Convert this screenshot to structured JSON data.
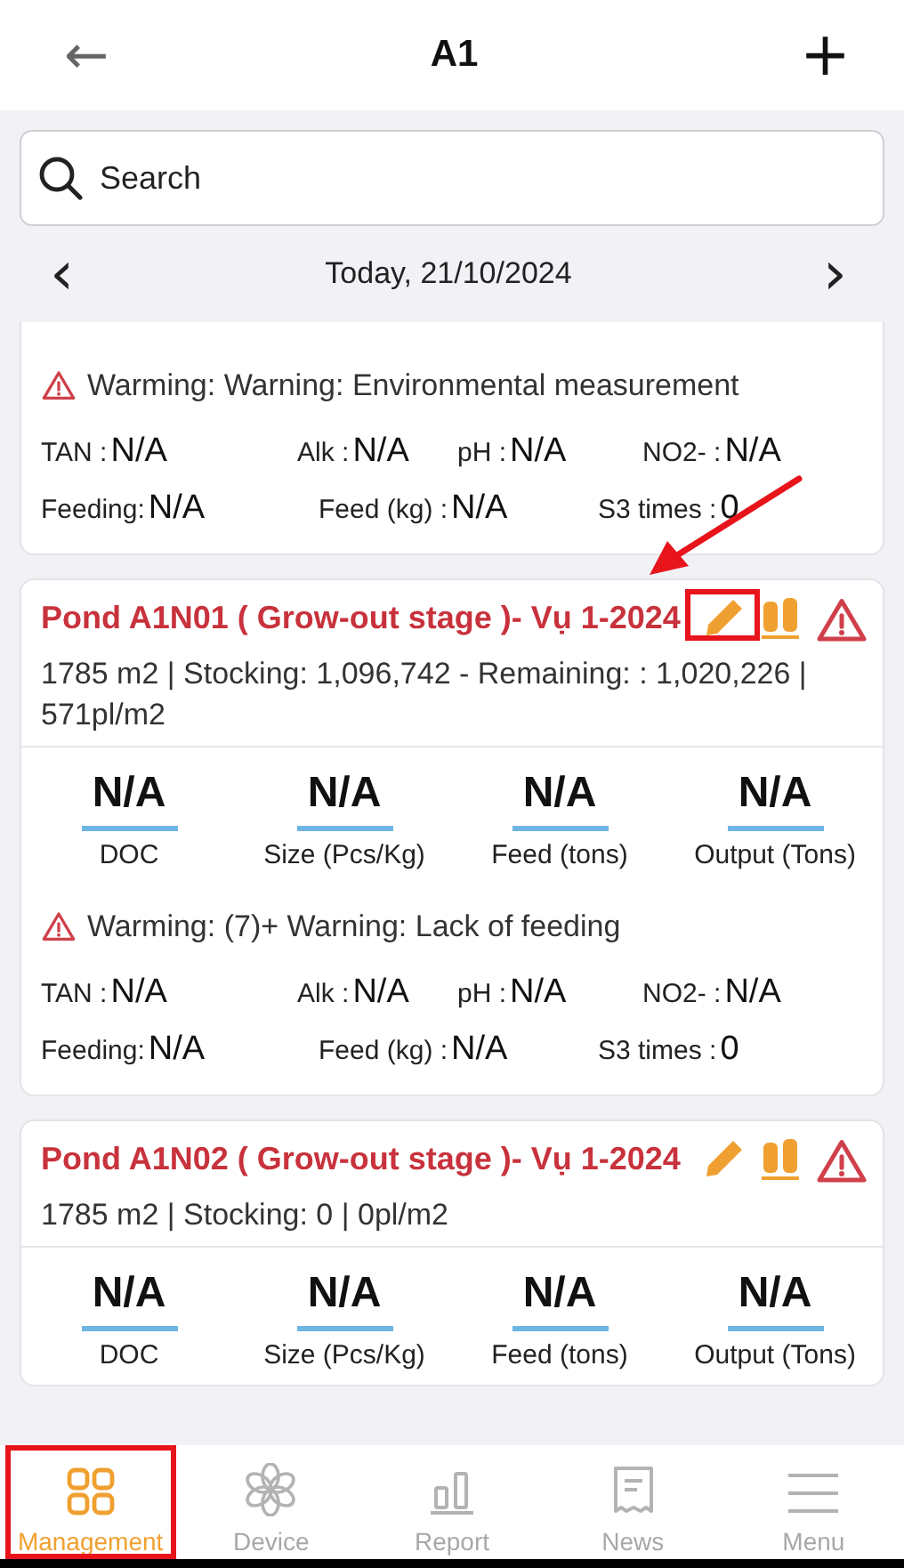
{
  "header": {
    "back": "←",
    "title": "A1",
    "add": "+"
  },
  "search": {
    "placeholder": "Search"
  },
  "date_nav": {
    "prev": "‹",
    "date": "Today, 21/10/2024",
    "next": "›"
  },
  "ponds": [
    {
      "warning": "Warming: Warning: Environmental measurement",
      "params": [
        {
          "label": "TAN :",
          "value": "N/A"
        },
        {
          "label": "Alk :",
          "value": "N/A"
        },
        {
          "label": "pH :",
          "value": "N/A"
        },
        {
          "label": "NO2- :",
          "value": "N/A"
        }
      ],
      "params2": [
        {
          "label": "Feeding:",
          "value": "N/A"
        },
        {
          "label": "Feed (kg) :",
          "value": "N/A"
        },
        {
          "label": "S3 times :",
          "value": "0"
        }
      ]
    },
    {
      "title": "Pond A1N01 ( Grow-out stage )- Vụ 1-2024",
      "details": "1785 m2 | Stocking: 1,096,742 - Remaining: : 1,020,226 | 571pl/m2",
      "edit_highlighted": true,
      "stats": [
        {
          "value": "N/A",
          "label": "DOC"
        },
        {
          "value": "N/A",
          "label": "Size (Pcs/Kg)"
        },
        {
          "value": "N/A",
          "label": "Feed (tons)"
        },
        {
          "value": "N/A",
          "label": "Output (Tons)"
        }
      ],
      "warning": "Warming: (7)+  Warning: Lack of feeding",
      "params": [
        {
          "label": "TAN :",
          "value": "N/A"
        },
        {
          "label": "Alk :",
          "value": "N/A"
        },
        {
          "label": "pH :",
          "value": "N/A"
        },
        {
          "label": "NO2- :",
          "value": "N/A"
        }
      ],
      "params2": [
        {
          "label": "Feeding:",
          "value": "N/A"
        },
        {
          "label": "Feed (kg) :",
          "value": "N/A"
        },
        {
          "label": "S3 times :",
          "value": "0"
        }
      ]
    },
    {
      "title": "Pond A1N02 ( Grow-out stage )- Vụ 1-2024",
      "details": "1785 m2 | Stocking: 0 | 0pl/m2",
      "edit_highlighted": false,
      "stats": [
        {
          "value": "N/A",
          "label": "DOC"
        },
        {
          "value": "N/A",
          "label": "Size (Pcs/Kg)"
        },
        {
          "value": "N/A",
          "label": "Feed (tons)"
        },
        {
          "value": "N/A",
          "label": "Output (Tons)"
        }
      ]
    }
  ],
  "nav": [
    {
      "kind": "grid",
      "label": "Management",
      "selected": true,
      "highlighted": true
    },
    {
      "kind": "fan",
      "label": "Device",
      "selected": false,
      "highlighted": false
    },
    {
      "kind": "chart",
      "label": "Report",
      "selected": false,
      "highlighted": false
    },
    {
      "kind": "news",
      "label": "News",
      "selected": false,
      "highlighted": false
    },
    {
      "kind": "menu",
      "label": "Menu",
      "selected": false,
      "highlighted": false
    }
  ]
}
